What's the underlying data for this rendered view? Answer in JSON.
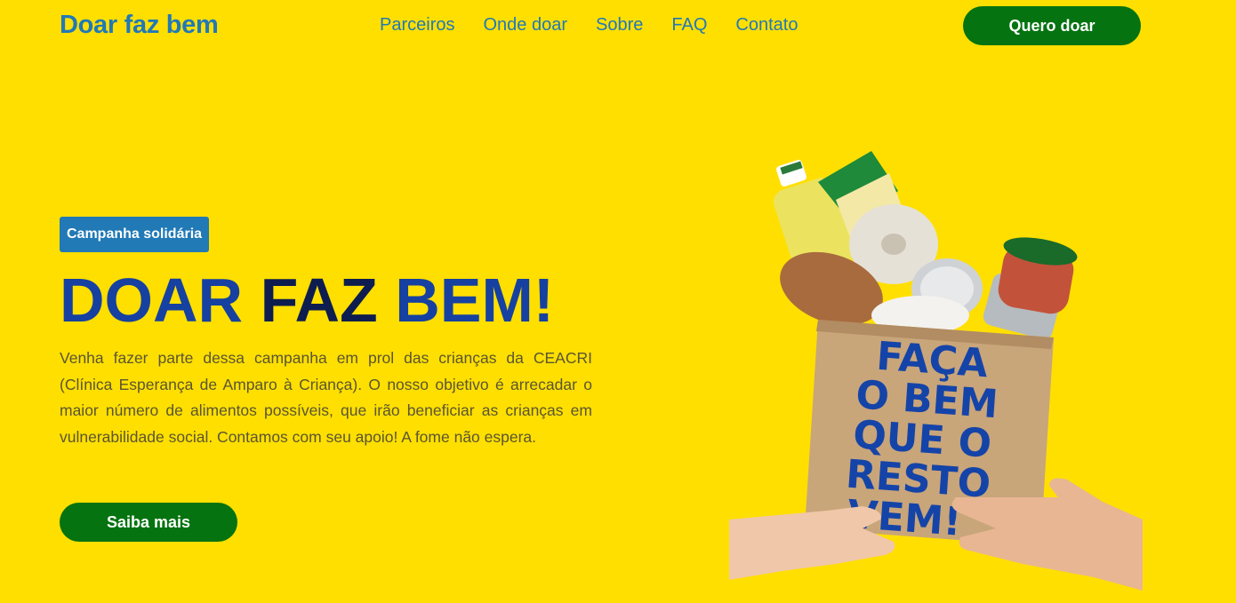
{
  "header": {
    "logo": "Doar faz bem",
    "nav": [
      "Parceiros",
      "Onde doar",
      "Sobre",
      "FAQ",
      "Contato"
    ],
    "cta": "Quero doar"
  },
  "hero": {
    "badge": "Campanha solidária",
    "title_part1": "DOAR ",
    "title_part2": "FAZ ",
    "title_part3": "BEM!",
    "description": "Venha fazer parte dessa campanha em prol das crianças da CEACRI (Clínica Esperança de Amparo à Criança). O nosso objetivo é arrecadar o maior número de alimentos possíveis, que irão beneficiar as crianças em vulnerabilidade social. Contamos com seu apoio! A fome não espera.",
    "button": "Saiba mais"
  },
  "image": {
    "box_lines": [
      "FAÇA",
      "O BEM",
      "QUE O",
      "RESTO",
      "VEM!"
    ]
  },
  "colors": {
    "background": "#ffdf00",
    "primary_blue": "#2179b6",
    "button_green": "#047310",
    "title_blue": "#1641a0",
    "title_dark": "#0e1d4f"
  }
}
